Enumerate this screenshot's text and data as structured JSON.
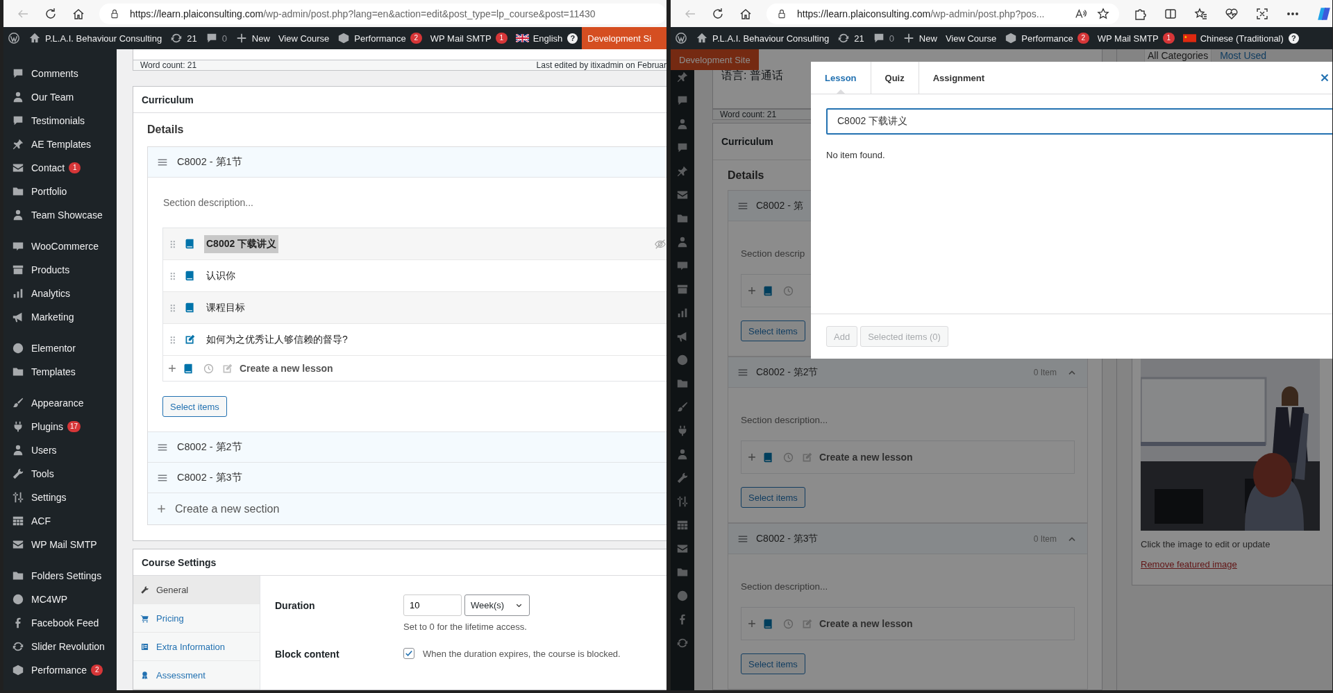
{
  "left_window": {
    "address": {
      "host": "https://learn.plaiconsulting.com",
      "path": "/wp-admin/post.php?lang=en&action=edit&post_type=lp_course&post=11430"
    },
    "admin_bar": {
      "site": "P.L.A.I. Behaviour Consulting",
      "updates": "21",
      "comments": "0",
      "new": "New",
      "view": "View Course",
      "performance": "Performance",
      "performance_badge": "2",
      "mail": "WP Mail SMTP",
      "mail_badge": "1",
      "language": "English",
      "help": "?",
      "dev_site": "Development Si"
    },
    "sidebar": [
      {
        "items": [
          {
            "label": "Comments"
          },
          {
            "label": "Our Team"
          },
          {
            "label": "Testimonials"
          },
          {
            "label": "AE Templates"
          },
          {
            "label": "Contact",
            "badge": "1"
          },
          {
            "label": "Portfolio"
          },
          {
            "label": "Team Showcase"
          }
        ]
      },
      {
        "items": [
          {
            "label": "WooCommerce"
          },
          {
            "label": "Products"
          },
          {
            "label": "Analytics"
          },
          {
            "label": "Marketing"
          }
        ]
      },
      {
        "items": [
          {
            "label": "Elementor"
          },
          {
            "label": "Templates"
          }
        ]
      },
      {
        "items": [
          {
            "label": "Appearance"
          },
          {
            "label": "Plugins",
            "badge": "17"
          },
          {
            "label": "Users"
          },
          {
            "label": "Tools"
          },
          {
            "label": "Settings"
          },
          {
            "label": "ACF"
          },
          {
            "label": "WP Mail SMTP"
          }
        ]
      },
      {
        "items": [
          {
            "label": "Folders Settings"
          },
          {
            "label": "MC4WP"
          },
          {
            "label": "Facebook Feed"
          },
          {
            "label": "Slider Revolution"
          },
          {
            "label": "Performance",
            "badge": "2"
          }
        ]
      }
    ],
    "editor_status": {
      "word_count": "Word count: 21",
      "last_edited": "Last edited by itixadmin on Februar"
    },
    "curriculum": {
      "title": "Curriculum",
      "details": "Details",
      "sections": [
        {
          "title": "C8002 - 第1节",
          "description_placeholder": "Section description...",
          "items": [
            {
              "title": "C8002 下载讲义",
              "kind": "lesson",
              "highlighted": true
            },
            {
              "title": "认识你",
              "kind": "lesson",
              "highlighted": false
            },
            {
              "title": "课程目标",
              "kind": "lesson",
              "highlighted": false
            },
            {
              "title": "如何为之优秀让人够信赖的督导?",
              "kind": "quiz",
              "highlighted": false
            }
          ],
          "new_item_placeholder": "Create a new lesson",
          "select_button": "Select items"
        },
        {
          "title": "C8002 - 第2节"
        },
        {
          "title": "C8002 - 第3节"
        }
      ],
      "new_section": "Create a new section"
    },
    "course_settings": {
      "title": "Course Settings",
      "tabs": [
        {
          "label": "General",
          "selected": true
        },
        {
          "label": "Pricing",
          "selected": false
        },
        {
          "label": "Extra Information",
          "selected": false
        },
        {
          "label": "Assessment",
          "selected": false
        }
      ],
      "duration": {
        "label": "Duration",
        "value": "10",
        "unit": "Week(s)",
        "hint": "Set to 0 for the lifetime access."
      },
      "block_content": {
        "label": "Block content",
        "checked": true,
        "text": "When the duration expires, the course is blocked."
      }
    }
  },
  "right_window": {
    "address": {
      "host": "https://learn.plaiconsulting.com",
      "path": "/wp-admin/post.php?pos..."
    },
    "admin_bar": {
      "site": "P.L.A.I. Behaviour Consulting",
      "updates": "21",
      "comments": "0",
      "new": "New",
      "view": "View Course",
      "performance": "Performance",
      "performance_badge": "2",
      "mail": "WP Mail SMTP",
      "mail_badge": "1",
      "language": "Chinese (Traditional)",
      "help": "?"
    },
    "dev_site": "Development Site",
    "editor": {
      "excerpt": "语言: 普通话",
      "word_count": "Word count: 21"
    },
    "curriculum": {
      "title": "Curriculum",
      "details": "Details",
      "sections": [
        {
          "title": "C8002 - 第",
          "description_placeholder": "Section descrip",
          "select_button": "Select items"
        },
        {
          "title": "C8002 - 第2节",
          "count": "0 Item",
          "description_placeholder": "Section description...",
          "new_item_placeholder": "Create a new lesson",
          "select_button": "Select items"
        },
        {
          "title": "C8002 - 第3节",
          "count": "0 Item",
          "description_placeholder": "Section description...",
          "new_item_placeholder": "Create a new lesson",
          "select_button": "Select items"
        }
      ]
    },
    "categories": {
      "tabs": [
        {
          "label": "All Categories",
          "selected": true
        },
        {
          "label": "Most Used",
          "selected": false
        }
      ]
    },
    "featured_image": {
      "kind": "picture",
      "hint": "Click the image to edit or update",
      "remove_link": "Remove featured image"
    },
    "modal": {
      "tabs": [
        {
          "label": "Lesson",
          "selected": true
        },
        {
          "label": "Quiz",
          "selected": false
        },
        {
          "label": "Assignment",
          "selected": false
        }
      ],
      "search": {
        "value": "C8002 下载讲义"
      },
      "empty_message": "No item found.",
      "buttons": [
        {
          "label": "Add",
          "disabled": true
        },
        {
          "label": "Selected items (0)",
          "disabled": true
        }
      ]
    }
  }
}
